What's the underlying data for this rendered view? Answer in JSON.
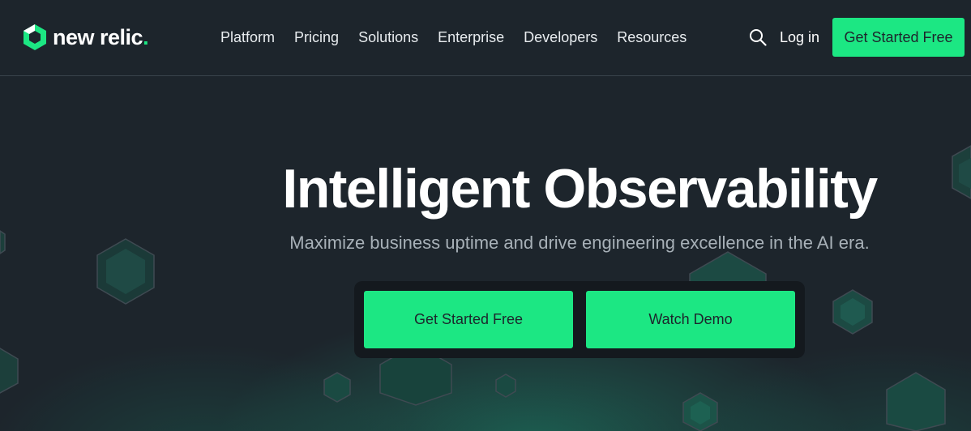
{
  "brand": {
    "name": "new relic",
    "dot": ".",
    "accent_color": "#1ce783",
    "background_color": "#1d252c"
  },
  "nav": {
    "items": [
      {
        "label": "Platform"
      },
      {
        "label": "Pricing"
      },
      {
        "label": "Solutions"
      },
      {
        "label": "Enterprise"
      },
      {
        "label": "Developers"
      },
      {
        "label": "Resources"
      }
    ]
  },
  "header": {
    "search_icon": "search-icon",
    "login_label": "Log in",
    "cta_label": "Get Started Free"
  },
  "hero": {
    "title": "Intelligent Observability",
    "subtitle": "Maximize business uptime and drive engineering excellence in the AI era.",
    "primary_cta": "Get Started Free",
    "secondary_cta": "Watch Demo"
  }
}
